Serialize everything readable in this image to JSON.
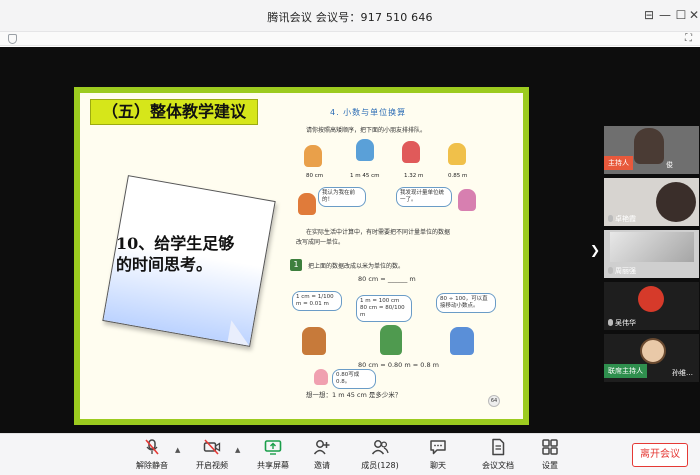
{
  "window": {
    "title": "腾讯会议  会议号：917 510 646"
  },
  "slide": {
    "title": "（五）整体教学建议",
    "note_text": "10、给学生足够的时间思考。",
    "book": {
      "chapter": "4. 小数与单位换算",
      "instruction": "请你按照高矮顺序，把下面的小朋友排排队。",
      "heights": [
        "80 cm",
        "1 m 45 cm",
        "1.32 m",
        "0.85 m"
      ],
      "bubble_1": "我认为我在前的！",
      "bubble_2": "我发现计量单位统一了。",
      "note_line_1": "在实际生活中计算中，有时需要把不同计量单位的数据",
      "note_line_2": "改写成同一单位。",
      "q_line": "把上面的数据改成以米为单位的数。",
      "q_eq": "80 cm = ______ m",
      "s1": "1 cm = 1/100 m = 0.01 m",
      "s2": "1 m = 100 cm\n80 cm = 80/100 m",
      "s3": "80 ÷ 100，可以直接移动小数点。",
      "answer": "80 cm = 0.80 m = 0.8 m",
      "bubble_3": "0.80写成0.8。",
      "think": "想一想：1 m 45 cm 是多少米？",
      "page": "64"
    }
  },
  "participants": [
    {
      "name": "俊",
      "badge": "主持人"
    },
    {
      "name": "卓艳霞"
    },
    {
      "name": "周丽强"
    },
    {
      "name": "吴伟华"
    },
    {
      "name": "孙维…",
      "badge": "联席主持人"
    }
  ],
  "toolbar": {
    "mute": "解除静音",
    "video": "开启视频",
    "share": "共享屏幕",
    "invite": "邀请",
    "members": "成员(128)",
    "chat": "聊天",
    "docs": "会议文档",
    "settings": "设置",
    "leave": "离开会议"
  },
  "colors": {
    "slide_border": "#9ccb1f",
    "slide_title_bg": "#d6e61a",
    "host_badge": "#e8593c",
    "leave": "#e53935"
  }
}
